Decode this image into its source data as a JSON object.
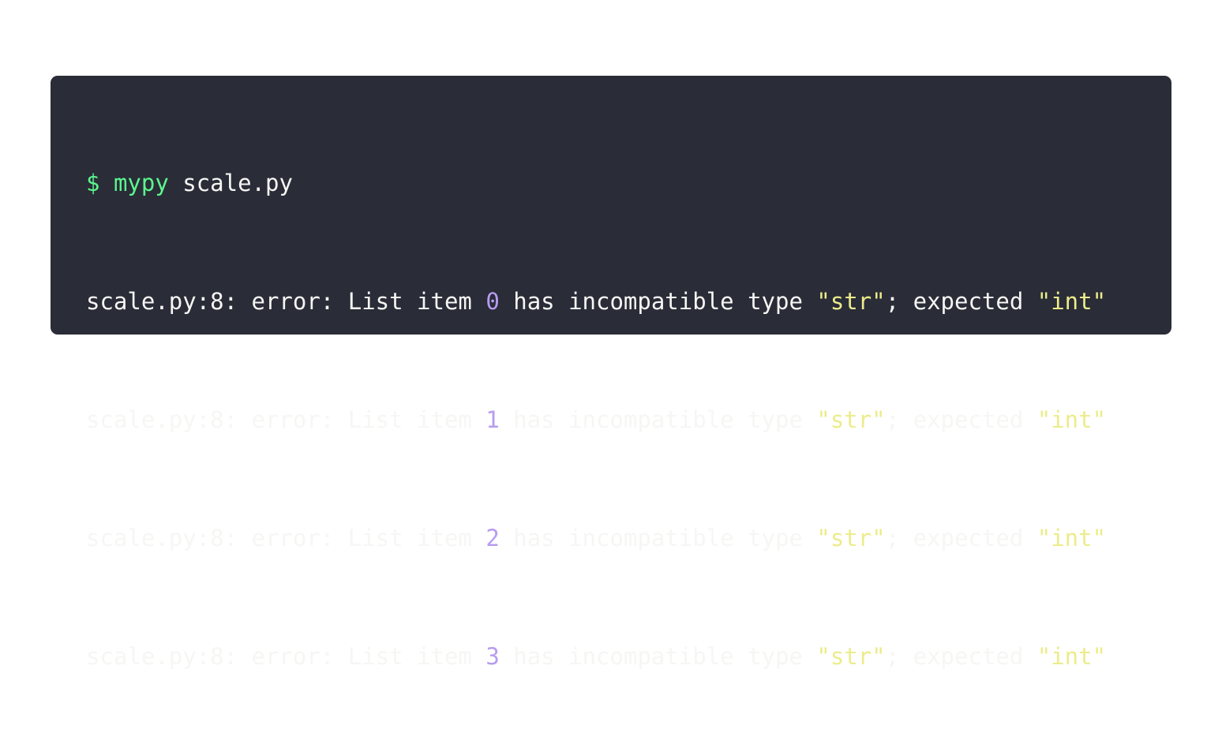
{
  "terminal": {
    "command_line": {
      "prompt": "$",
      "command": "mypy",
      "argument": "scale.py"
    },
    "errors": [
      {
        "prefix": "scale.py:8: error: List item ",
        "index": "0",
        "mid": " has incompatible type ",
        "got": "\"str\"",
        "sep": "; expected ",
        "expected": "\"int\""
      },
      {
        "prefix": "scale.py:8: error: List item ",
        "index": "1",
        "mid": " has incompatible type ",
        "got": "\"str\"",
        "sep": "; expected ",
        "expected": "\"int\""
      },
      {
        "prefix": "scale.py:8: error: List item ",
        "index": "2",
        "mid": " has incompatible type ",
        "got": "\"str\"",
        "sep": "; expected ",
        "expected": "\"int\""
      },
      {
        "prefix": "scale.py:8: error: List item ",
        "index": "3",
        "mid": " has incompatible type ",
        "got": "\"str\"",
        "sep": "; expected ",
        "expected": "\"int\""
      }
    ]
  },
  "colors": {
    "background": "#2a2c37",
    "text": "#f6f6f4",
    "prompt": "#5af78e",
    "number": "#b79cf0",
    "string": "#ecec8c"
  }
}
